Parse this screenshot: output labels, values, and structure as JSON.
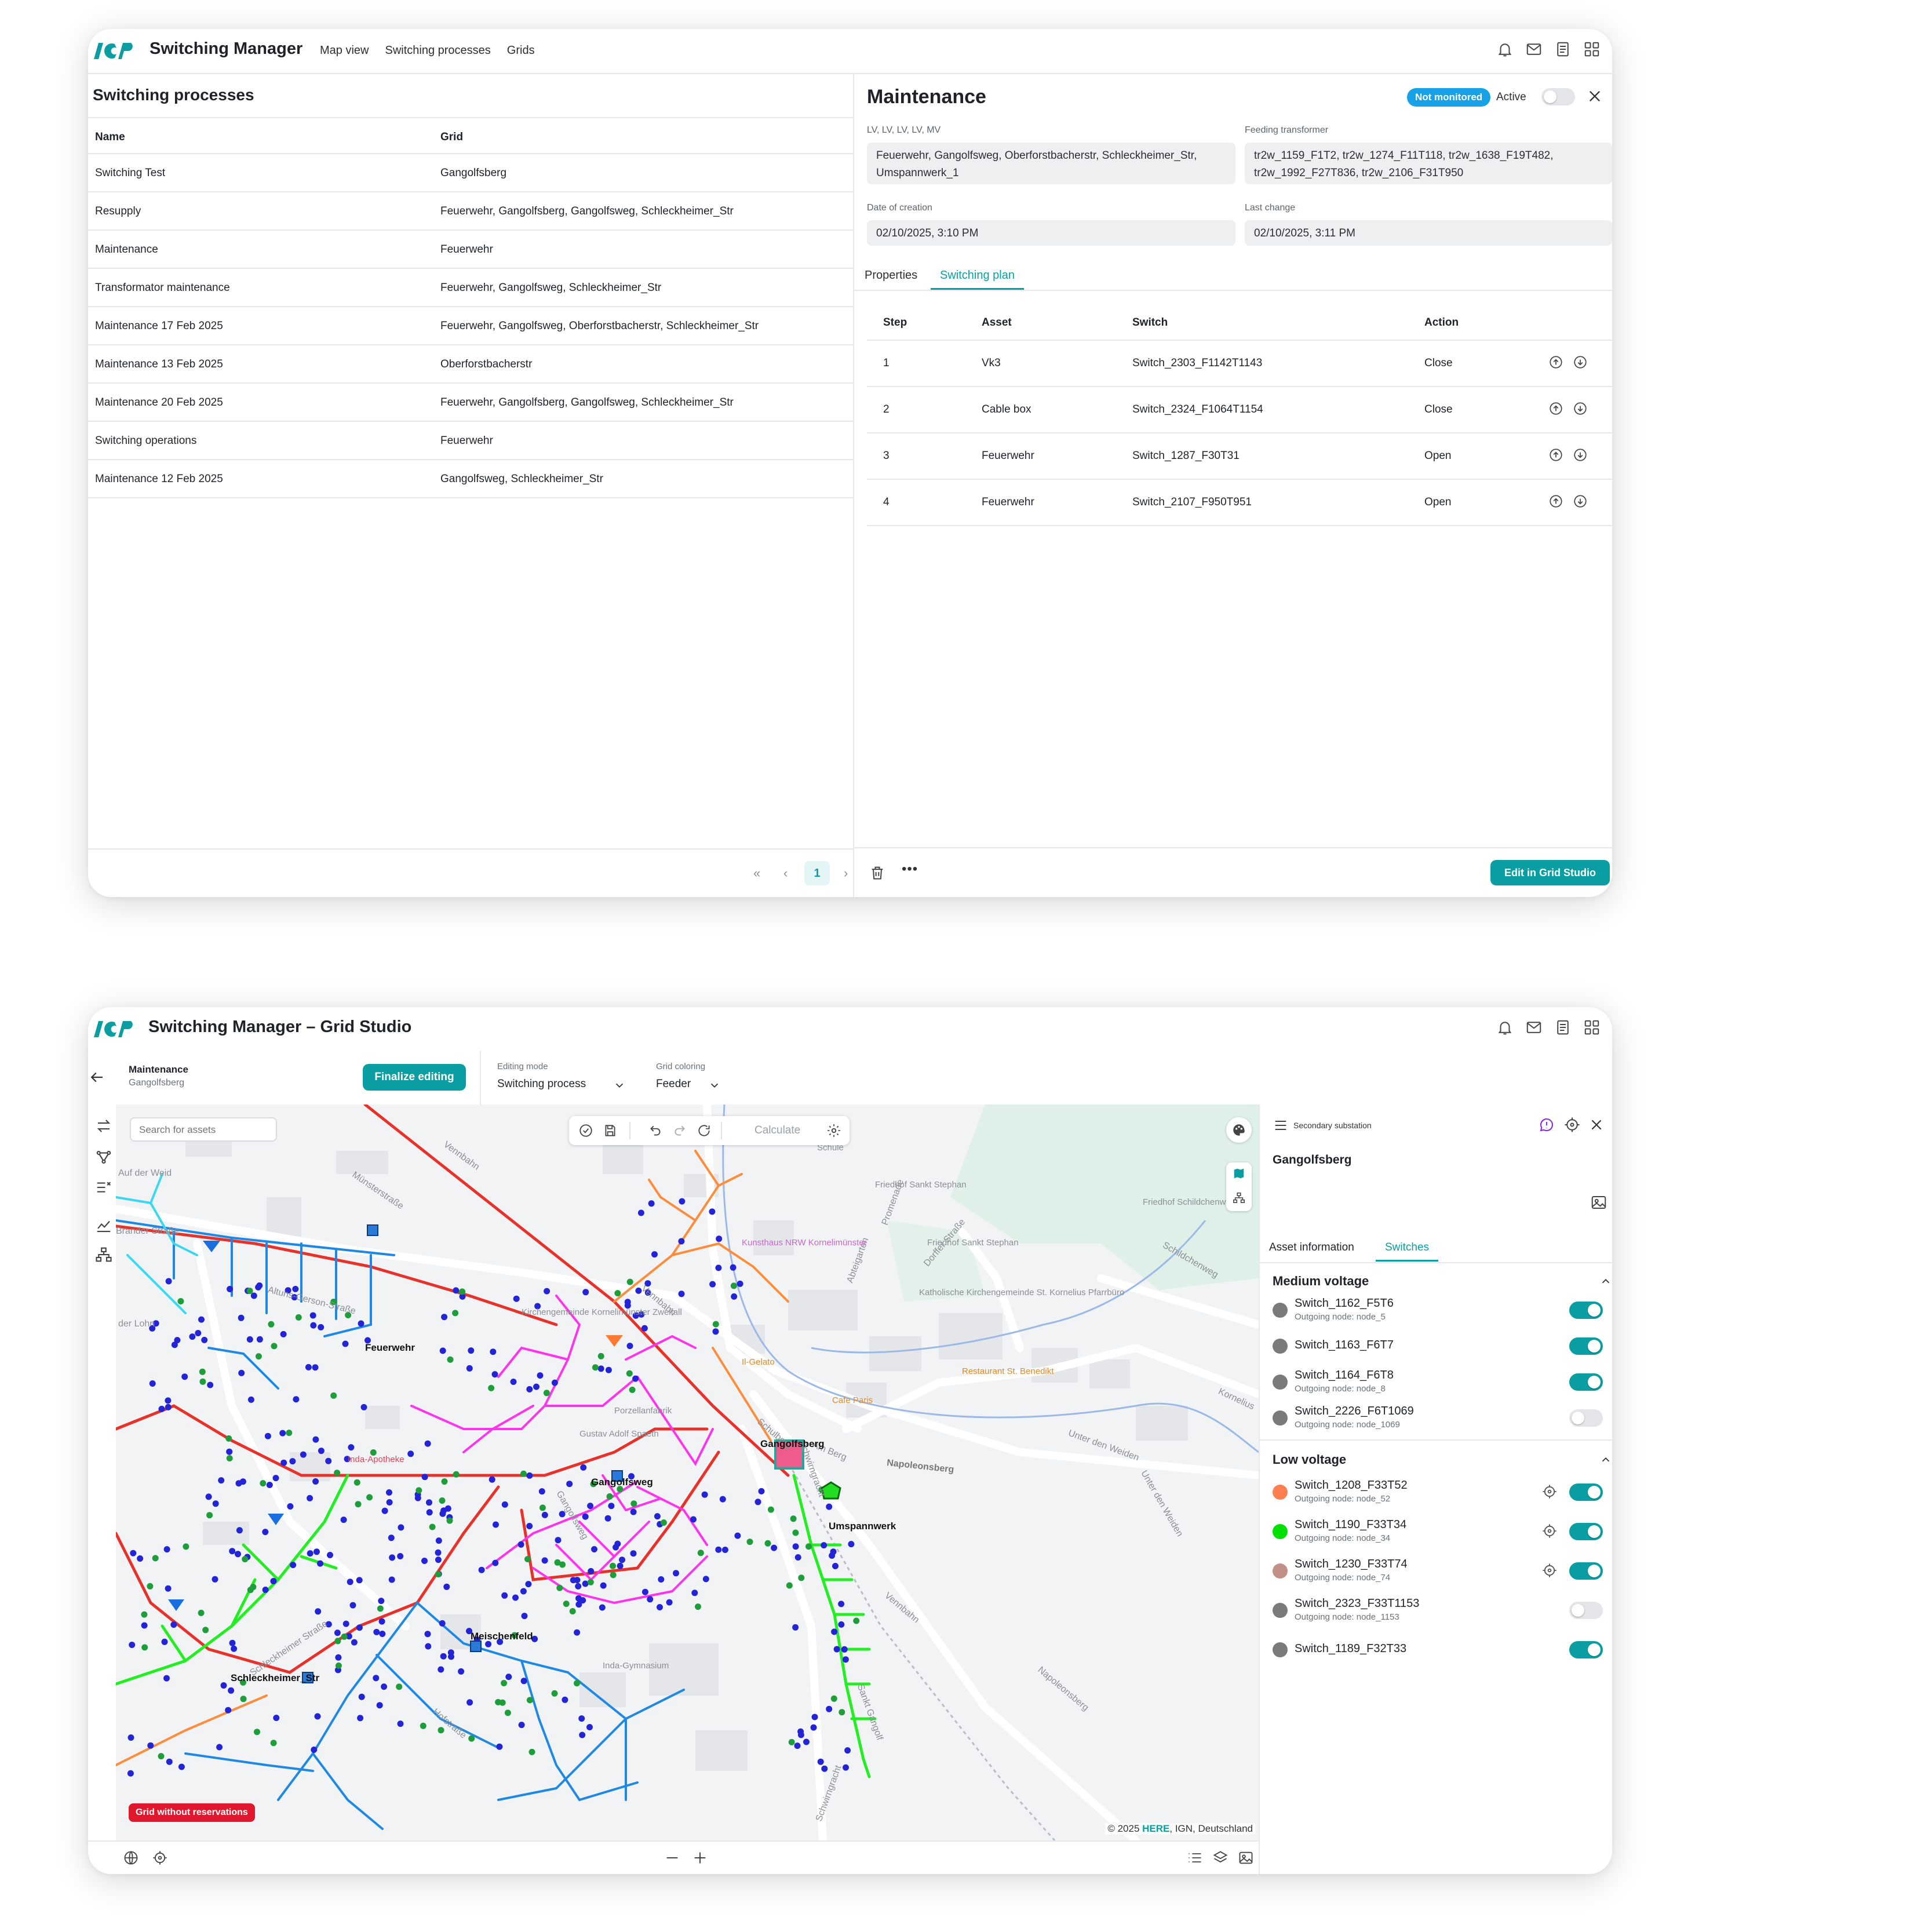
{
  "window1": {
    "app_title": "Switching Manager",
    "nav": [
      "Map view",
      "Switching processes",
      "Grids"
    ],
    "list": {
      "title": "Switching processes",
      "columns": [
        "Name",
        "Grid"
      ],
      "rows": [
        {
          "name": "Switching Test",
          "grid": "Gangolfsberg"
        },
        {
          "name": "Resupply",
          "grid": "Feuerwehr, Gangolfsberg, Gangolfsweg, Schleckheimer_Str"
        },
        {
          "name": "Maintenance",
          "grid": "Feuerwehr"
        },
        {
          "name": "Transformator maintenance",
          "grid": "Feuerwehr, Gangolfsweg, Schleckheimer_Str"
        },
        {
          "name": "Maintenance 17 Feb 2025",
          "grid": "Feuerwehr, Gangolfsweg, Oberforstbacherstr, Schleckheimer_Str"
        },
        {
          "name": "Maintenance 13 Feb 2025",
          "grid": "Oberforstbacherstr"
        },
        {
          "name": "Maintenance 20 Feb 2025",
          "grid": "Feuerwehr, Gangolfsberg, Gangolfsweg, Schleckheimer_Str"
        },
        {
          "name": "Switching operations",
          "grid": "Feuerwehr"
        },
        {
          "name": "Maintenance 12 Feb 2025",
          "grid": "Gangolfsweg, Schleckheimer_Str"
        }
      ],
      "pager": {
        "first": "«",
        "prev": "‹",
        "current": "1",
        "next": "›"
      }
    },
    "detail": {
      "title": "Maintenance",
      "status_badge": "Not monitored",
      "active_label": "Active",
      "active": false,
      "fields": {
        "voltage_label": "LV, LV, LV, LV, MV",
        "voltage_value": "Feuerwehr, Gangolfsweg, Oberforstbacherstr, Schleckheimer_Str, Umspannwerk_1",
        "transformer_label": "Feeding transformer",
        "transformer_value": "tr2w_1159_F1T2, tr2w_1274_F11T118, tr2w_1638_F19T482, tr2w_1992_F27T836, tr2w_2106_F31T950",
        "created_label": "Date of creation",
        "created_value": "02/10/2025, 3:10 PM",
        "changed_label": "Last change",
        "changed_value": "02/10/2025, 3:11 PM"
      },
      "tabs": [
        "Properties",
        "Switching plan"
      ],
      "active_tab": "Switching plan",
      "plan_columns": [
        "Step",
        "Asset",
        "Switch",
        "Action"
      ],
      "plan_rows": [
        {
          "step": "1",
          "asset": "Vk3",
          "switch": "Switch_2303_F1142T1143",
          "action": "Close"
        },
        {
          "step": "2",
          "asset": "Cable box",
          "switch": "Switch_2324_F1064T1154",
          "action": "Close"
        },
        {
          "step": "3",
          "asset": "Feuerwehr",
          "switch": "Switch_1287_F30T31",
          "action": "Open"
        },
        {
          "step": "4",
          "asset": "Feuerwehr",
          "switch": "Switch_2107_F950T951",
          "action": "Open"
        }
      ],
      "more_label": "•••",
      "edit_button": "Edit in Grid Studio"
    }
  },
  "window2": {
    "app_title": "Switching Manager – Grid Studio",
    "context_title": "Maintenance",
    "context_subtitle": "Gangolfsberg",
    "finalize_button": "Finalize editing",
    "editing_mode_label": "Editing mode",
    "editing_mode_value": "Switching process",
    "coloring_label": "Grid coloring",
    "coloring_value": "Feeder",
    "search_placeholder": "Search for assets",
    "calculate_label": "Calculate",
    "reservation_badge": "Grid without reservations",
    "attribution_prefix": "© 2025 ",
    "attribution_brand": "HERE",
    "attribution_suffix": ", IGN, Deutschland",
    "map_labels": {
      "streets": [
        "Vennbahn",
        "Münsterstraße",
        "Altuns-Gerson-Straße",
        "Am Berg",
        "Napoleonsberg",
        "Unter den Weiden",
        "Schildchenweg",
        "Kornelius",
        "Schleckheimer Straße",
        "Abteigarten",
        "Promenade",
        "Dorffer Straße",
        "Schulberg",
        "Schwirngracht",
        "Vennbahn",
        "Napoleonsberg",
        "Unter den Weiden",
        "Sankt Gangolf",
        "Schwirngracht",
        "der Lohn",
        "Auf der Weid",
        "Brander Straße",
        "Gangolfsweg",
        "Vennbahn",
        "Hofstraße"
      ],
      "grids": [
        "Feuerwehr",
        "Gangolfsberg",
        "Gangolfsweg",
        "Umspannwerk",
        "Meischenfeld",
        "Schleckheimer_Str"
      ],
      "pois": [
        "Friedhof Sankt Stephan",
        "Friedhof Schildchenweg",
        "Friedhof Sankt Stephan",
        "Katholische Kirchengemeinde St. Kornelius Pfarrbüro",
        "Restaurant St. Benedikt",
        "Cafe Paris",
        "Il-Gelato",
        "Kunsthaus NRW Kornelimünster",
        "Kirchengemeinde Kornelimünster Zweifall",
        "Inda-Apotheke",
        "Inda-Gymnasium",
        "Gustav Adolf Spaeth",
        "Porzellanfabrik",
        "Schule"
      ]
    },
    "side": {
      "type_label": "Secondary substation",
      "title": "Gangolfsberg",
      "tabs": [
        "Asset information",
        "Switches"
      ],
      "active_tab": "Switches",
      "medium_voltage": {
        "title": "Medium voltage",
        "items": [
          {
            "name": "Switch_1162_F5T6",
            "sub": "Outgoing node: node_5",
            "color": "#7a7a7a",
            "on": true,
            "locate": false
          },
          {
            "name": "Switch_1163_F6T7",
            "sub": "",
            "color": "#7a7a7a",
            "on": true,
            "locate": false
          },
          {
            "name": "Switch_1164_F6T8",
            "sub": "Outgoing node: node_8",
            "color": "#7a7a7a",
            "on": true,
            "locate": false
          },
          {
            "name": "Switch_2226_F6T1069",
            "sub": "Outgoing node: node_1069",
            "color": "#7a7a7a",
            "on": false,
            "locate": false
          }
        ]
      },
      "low_voltage": {
        "title": "Low voltage",
        "items": [
          {
            "name": "Switch_1208_F33T52",
            "sub": "Outgoing node: node_52",
            "color": "#ff7f50",
            "on": true,
            "locate": true
          },
          {
            "name": "Switch_1190_F33T34",
            "sub": "Outgoing node: node_34",
            "color": "#00e000",
            "on": true,
            "locate": true
          },
          {
            "name": "Switch_1230_F33T74",
            "sub": "Outgoing node: node_74",
            "color": "#c39088",
            "on": true,
            "locate": true
          },
          {
            "name": "Switch_2323_F33T1153",
            "sub": "Outgoing node: node_1153",
            "color": "#7a7a7a",
            "on": false,
            "locate": false
          },
          {
            "name": "Switch_1189_F32T33",
            "sub": "",
            "color": "#7a7a7a",
            "on": true,
            "locate": false
          }
        ]
      }
    }
  },
  "colors": {
    "accent": "#0a9ea3",
    "badge_blue": "#17a2e8",
    "badge_red": "#e0182d",
    "mv_line": "#e8312a",
    "feeder_blue": "#1e88e5",
    "feeder_magenta": "#ff33ee",
    "feeder_green": "#22ee22",
    "feeder_orange": "#ff8c3a",
    "feeder_cyan": "#3bd8ee"
  }
}
